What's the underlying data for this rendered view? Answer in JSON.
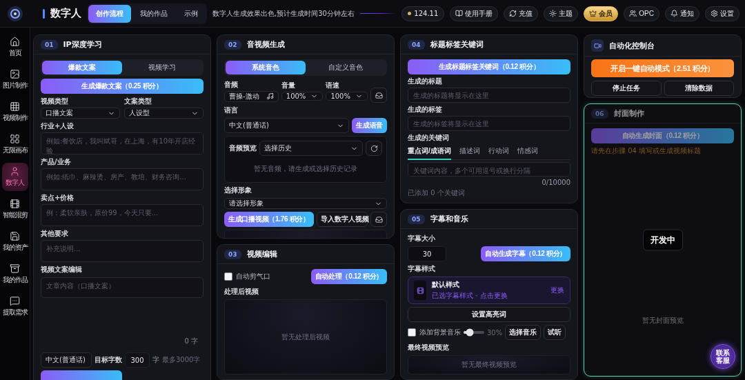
{
  "header": {
    "title": "数字人",
    "tabs": [
      {
        "label": "创作流程",
        "selected": true
      },
      {
        "label": "我的作品",
        "selected": false
      },
      {
        "label": "示例",
        "selected": false
      }
    ],
    "notice": "数字人生成效果出色,预计生成时间30分钟左右",
    "points": "124.11",
    "actions": [
      {
        "label": "使用手册",
        "kind": "plain"
      },
      {
        "label": "充值",
        "kind": "plain"
      },
      {
        "label": "主题",
        "kind": "plain"
      },
      {
        "label": "会员",
        "kind": "gold"
      },
      {
        "label": "OPC",
        "kind": "plain"
      },
      {
        "label": "通知",
        "kind": "plain"
      },
      {
        "label": "设置",
        "kind": "plain"
      }
    ]
  },
  "sidebar": {
    "items": [
      {
        "label": "首页",
        "selected": false
      },
      {
        "label": "图片制作",
        "selected": false
      },
      {
        "label": "视频制作",
        "selected": false
      },
      {
        "label": "无限画布",
        "selected": false
      },
      {
        "label": "数字人",
        "selected": true
      },
      {
        "label": "智能混剪",
        "selected": false
      },
      {
        "label": "我的资产",
        "selected": false
      },
      {
        "label": "我的作品",
        "selected": false
      },
      {
        "label": "提取需求",
        "selected": false
      }
    ]
  },
  "ip_learning": {
    "step": "01",
    "title": "IP深度学习",
    "tabs": [
      {
        "label": "爆款文案",
        "selected": true
      },
      {
        "label": "视频学习",
        "selected": false
      }
    ],
    "generate": "生成爆款文案（0.25 积分）",
    "selects": [
      {
        "label": "视频类型",
        "value": "口播文案"
      },
      {
        "label": "文案类型",
        "value": "人设型"
      }
    ],
    "inputs": [
      {
        "label": "行业+人设",
        "placeholder": "例如:餐饮店，我叫斌哥，在上海，有10年开店经验"
      },
      {
        "label": "产品/业务",
        "placeholder": "例如:纸巾、麻辣烫、房产、教培、财务咨询..."
      },
      {
        "label": "卖点+价格",
        "placeholder": "例：柔软亲肤，原价99，今天只要..."
      },
      {
        "label": "其他要求",
        "placeholder": "补充说明..."
      }
    ],
    "script": {
      "label": "视频文案编辑",
      "placeholder": "文章内容（口播文案）",
      "count": "0 字"
    },
    "language": "中文(普通话)",
    "target_label": "目标字数",
    "target_value": "300",
    "target_unit": "字",
    "target_hint": "最多3000字"
  },
  "audio_video": {
    "step": "02",
    "title": "音视频生成",
    "tabs": [
      {
        "label": "系统音色",
        "selected": true
      },
      {
        "label": "自定义音色",
        "selected": false
      }
    ],
    "voice": {
      "label": "音频",
      "value": "曹操-激动"
    },
    "volume": {
      "label": "音量",
      "value": "100%"
    },
    "speed": {
      "label": "语速",
      "value": "100%"
    },
    "language": {
      "label": "语言",
      "value": "中文(普通话)"
    },
    "generate_voice": "生成语音",
    "preview": {
      "label": "音频预览",
      "select": "选择历史",
      "empty": "暂无音频，请生成或选择历史记录"
    },
    "avatar": {
      "label": "选择形象",
      "value": "请选择形象"
    },
    "generate_video": "生成口播视频（1.76 积分）",
    "import": "导入数字人视频"
  },
  "video_edit": {
    "step": "03",
    "title": "视频编辑",
    "auto_cut": {
      "label": "自动剪气口",
      "checked": false
    },
    "process": "自动处理（0.12 积分）",
    "result_label": "处理后视频",
    "empty": "暂无处理后视频"
  },
  "titles": {
    "step": "04",
    "title": "标题标签关键词",
    "generate": "生成标题标签关键词（0.12 积分）",
    "fields": [
      {
        "label": "生成的标题",
        "placeholder": "生成的标题将显示在这里"
      },
      {
        "label": "生成的标签",
        "placeholder": "生成的标签将显示在这里"
      }
    ],
    "keywords_label": "生成的关键词",
    "keyword_tabs": [
      {
        "label": "重点词/成语词",
        "selected": true
      },
      {
        "label": "描述词",
        "selected": false
      },
      {
        "label": "行动词",
        "selected": false
      },
      {
        "label": "情感词",
        "selected": false
      }
    ],
    "keywords_placeholder": "关键词内容，多个可用逗号或换行分隔",
    "counter": "0/10000",
    "footer": "已添加 0 个关键词"
  },
  "subtitles": {
    "step": "05",
    "title": "字幕和音乐",
    "size_label": "字幕大小",
    "size_value": "30",
    "auto": "自动生成字幕（0.12 积分）",
    "style_label": "字幕样式",
    "style": {
      "name": "默认样式",
      "hint": "已选字幕样式 · 点击更换",
      "action": "更换"
    },
    "highlight": "设置高亮词",
    "bgm": {
      "label": "添加背景音乐",
      "checked": false,
      "level": 0.3,
      "reading": "30%"
    },
    "choose_music": "选择音乐",
    "listen": "试听",
    "preview_label": "最终视频预览",
    "empty": "暂无最终视频预览"
  },
  "control": {
    "title": "自动化控制台",
    "start": "开启一键自动模式（2.51 积分）",
    "stop": "停止任务",
    "clear": "清除数据"
  },
  "cover": {
    "step": "06",
    "title": "封面制作",
    "generate": "自动生成封面（0.12 积分）",
    "warning": "请先在步骤 04 填写或生成视频标题",
    "empty": "暂无封面预览",
    "overlay": "开发中",
    "support": "联系客服"
  }
}
